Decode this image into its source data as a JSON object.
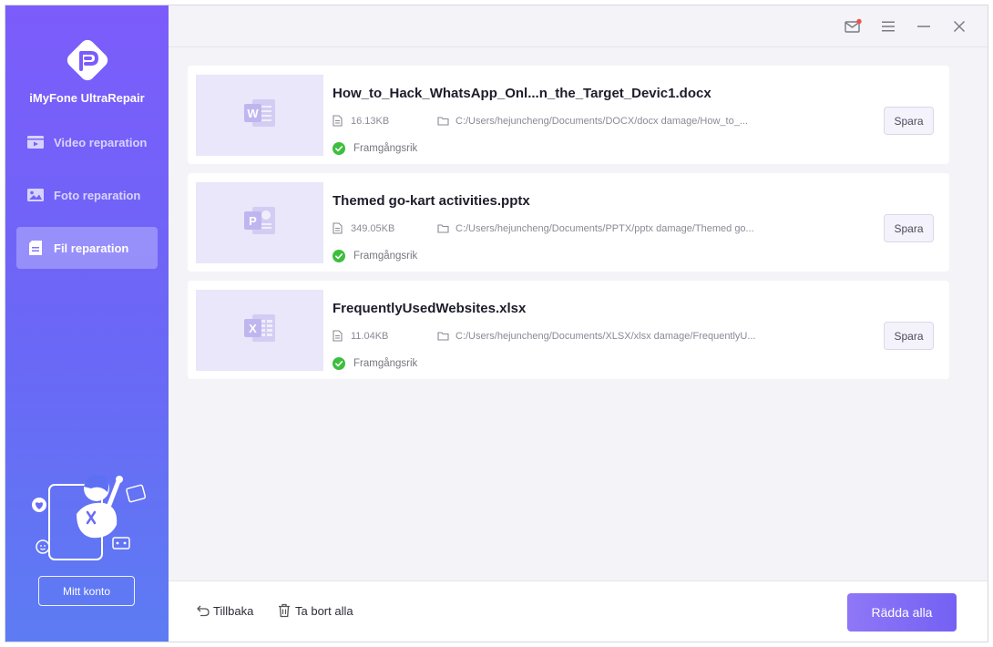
{
  "app": {
    "name": "iMyFone UltraRepair"
  },
  "sidebar": {
    "items": [
      {
        "label": "Video reparation",
        "icon": "video-icon",
        "active": false
      },
      {
        "label": "Foto reparation",
        "icon": "photo-icon",
        "active": false
      },
      {
        "label": "Fil reparation",
        "icon": "file-icon",
        "active": true
      }
    ],
    "account_label": "Mitt konto"
  },
  "titlebar": {
    "icons": [
      "mail-icon",
      "menu-icon",
      "minimize-icon",
      "close-icon"
    ]
  },
  "files": [
    {
      "name": "How_to_Hack_WhatsApp_Onl...n_the_Target_Devic1.docx",
      "size": "16.13KB",
      "path": "C:/Users/hejuncheng/Documents/DOCX/docx damage/How_to_...",
      "status": "Framgångsrik",
      "type_icon": "word-icon",
      "type_letter": "W",
      "save_label": "Spara"
    },
    {
      "name": "Themed go-kart activities.pptx",
      "size": "349.05KB",
      "path": "C:/Users/hejuncheng/Documents/PPTX/pptx damage/Themed go...",
      "status": "Framgångsrik",
      "type_icon": "powerpoint-icon",
      "type_letter": "P",
      "save_label": "Spara"
    },
    {
      "name": "FrequentlyUsedWebsites.xlsx",
      "size": "11.04KB",
      "path": "C:/Users/hejuncheng/Documents/XLSX/xlsx damage/FrequentlyU...",
      "status": "Framgångsrik",
      "type_icon": "excel-icon",
      "type_letter": "X",
      "save_label": "Spara"
    }
  ],
  "footer": {
    "back_label": "Tillbaka",
    "delete_all_label": "Ta bort alla",
    "save_all_label": "Rädda alla"
  },
  "colors": {
    "sidebar_top": "#7c5cfb",
    "sidebar_bottom": "#5d7cf3",
    "accent": "#7461f3",
    "success": "#3dbf3d",
    "thumb_bg": "#e9e7f9"
  }
}
